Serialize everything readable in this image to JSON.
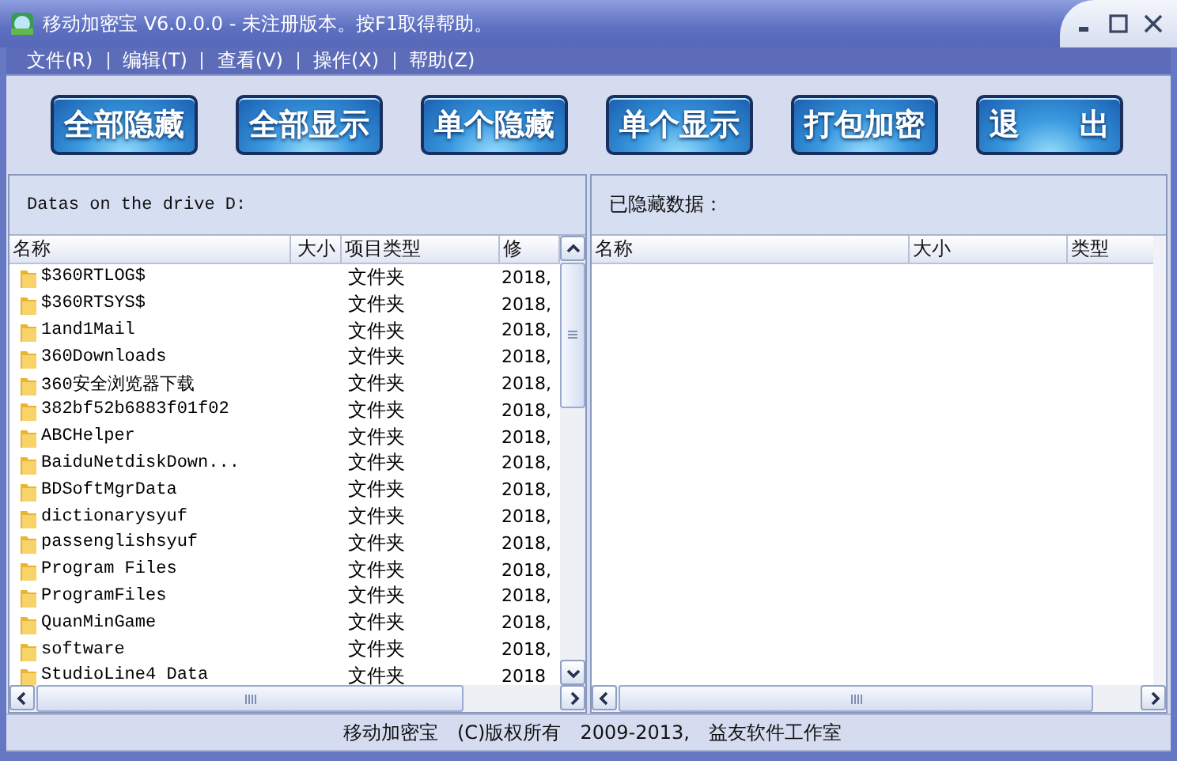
{
  "window": {
    "title": "移动加密宝 V6.0.0.0 - 未注册版本。按F1取得帮助。"
  },
  "menu": [
    {
      "label": "文件(R)"
    },
    {
      "label": "编辑(T)"
    },
    {
      "label": "查看(V)"
    },
    {
      "label": "操作(X)"
    },
    {
      "label": "帮助(Z)"
    }
  ],
  "toolbar": [
    "全部隐藏",
    "全部显示",
    "单个隐藏",
    "单个显示",
    "打包加密",
    "退　　出"
  ],
  "left_pane": {
    "heading": "Datas on the drive D:",
    "columns": [
      "名称",
      "大小",
      "项目类型",
      "修"
    ],
    "rows": [
      {
        "name": "$360RTLOG$",
        "type": "文件夹",
        "modified": "2018,"
      },
      {
        "name": "$360RTSYS$",
        "type": "文件夹",
        "modified": "2018,"
      },
      {
        "name": "1and1Mail",
        "type": "文件夹",
        "modified": "2018,"
      },
      {
        "name": "360Downloads",
        "type": "文件夹",
        "modified": "2018,"
      },
      {
        "name": "360安全浏览器下载",
        "type": "文件夹",
        "modified": "2018,"
      },
      {
        "name": "382bf52b6883f01f02",
        "type": "文件夹",
        "modified": "2018,"
      },
      {
        "name": "ABCHelper",
        "type": "文件夹",
        "modified": "2018,"
      },
      {
        "name": "BaiduNetdiskDown...",
        "type": "文件夹",
        "modified": "2018,"
      },
      {
        "name": "BDSoftMgrData",
        "type": "文件夹",
        "modified": "2018,"
      },
      {
        "name": "dictionarysyuf",
        "type": "文件夹",
        "modified": "2018,"
      },
      {
        "name": "passenglishsyuf",
        "type": "文件夹",
        "modified": "2018,"
      },
      {
        "name": "Program Files",
        "type": "文件夹",
        "modified": "2018,"
      },
      {
        "name": "ProgramFiles",
        "type": "文件夹",
        "modified": "2018,"
      },
      {
        "name": "QuanMinGame",
        "type": "文件夹",
        "modified": "2018,"
      },
      {
        "name": "software",
        "type": "文件夹",
        "modified": "2018,"
      },
      {
        "name": "StudioLine4 Data",
        "type": "文件夹",
        "modified": "2018"
      }
    ]
  },
  "right_pane": {
    "heading": "已隐藏数据：",
    "columns": [
      "名称",
      "大小",
      "类型"
    ]
  },
  "status_bar": [
    "移动加密宝",
    "(C)版权所有",
    "2009-2013,",
    "益友软件工作室"
  ]
}
